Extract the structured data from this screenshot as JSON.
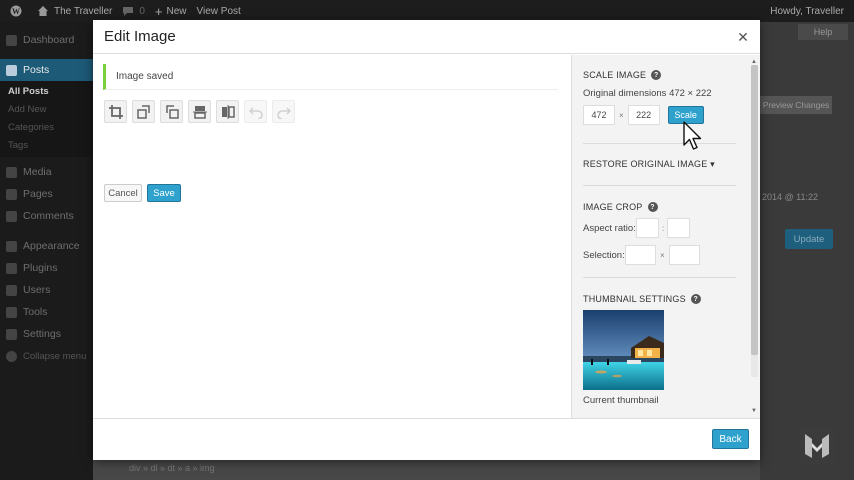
{
  "adminbar": {
    "site_name": "The Traveller",
    "new_label": "New",
    "view_post": "View Post",
    "greeting": "Howdy, Traveller"
  },
  "sidebar": {
    "items": [
      {
        "label": "Dashboard",
        "icon": "dashboard-icon"
      },
      {
        "label": "Posts",
        "icon": "pin-icon",
        "active": true
      },
      {
        "label": "Media",
        "icon": "media-icon"
      },
      {
        "label": "Pages",
        "icon": "pages-icon"
      },
      {
        "label": "Comments",
        "icon": "comments-icon"
      },
      {
        "label": "Appearance",
        "icon": "appearance-icon"
      },
      {
        "label": "Plugins",
        "icon": "plugins-icon"
      },
      {
        "label": "Users",
        "icon": "users-icon"
      },
      {
        "label": "Tools",
        "icon": "tools-icon"
      },
      {
        "label": "Settings",
        "icon": "settings-icon"
      },
      {
        "label": "Collapse menu",
        "icon": "collapse-icon"
      }
    ],
    "submenu": [
      "All Posts",
      "Add New",
      "Categories",
      "Tags"
    ]
  },
  "background": {
    "preview_changes": "Preview Changes",
    "date": "2014 @ 11:22",
    "update": "Update",
    "help": "Help",
    "breadcrumb": "div » dl » dt » a » img"
  },
  "modal": {
    "title": "Edit Image",
    "notice": "Image saved",
    "cancel": "Cancel",
    "save": "Save",
    "back": "Back",
    "tools": [
      {
        "name": "crop-icon",
        "disabled": false
      },
      {
        "name": "rotate-left-icon",
        "disabled": false
      },
      {
        "name": "rotate-right-icon",
        "disabled": false
      },
      {
        "name": "flip-vertical-icon",
        "disabled": false
      },
      {
        "name": "flip-horizontal-icon",
        "disabled": false
      },
      {
        "name": "undo-icon",
        "disabled": true
      },
      {
        "name": "redo-icon",
        "disabled": true
      }
    ],
    "scale": {
      "title": "SCALE IMAGE",
      "original": "Original dimensions 472 × 222",
      "width": "472",
      "height": "222",
      "times": "×",
      "button": "Scale"
    },
    "restore": {
      "title": "RESTORE ORIGINAL IMAGE ▾"
    },
    "crop": {
      "title": "IMAGE CROP",
      "aspect_label": "Aspect ratio:",
      "aspect_sep": ":",
      "selection_label": "Selection:",
      "selection_sep": "×"
    },
    "thumbnail": {
      "title": "THUMBNAIL SETTINGS",
      "caption": "Current thumbnail"
    }
  },
  "colors": {
    "primary_button": "#2ea2cc",
    "notice_border": "#7ad03a",
    "active_menu": "#1d5a78"
  }
}
